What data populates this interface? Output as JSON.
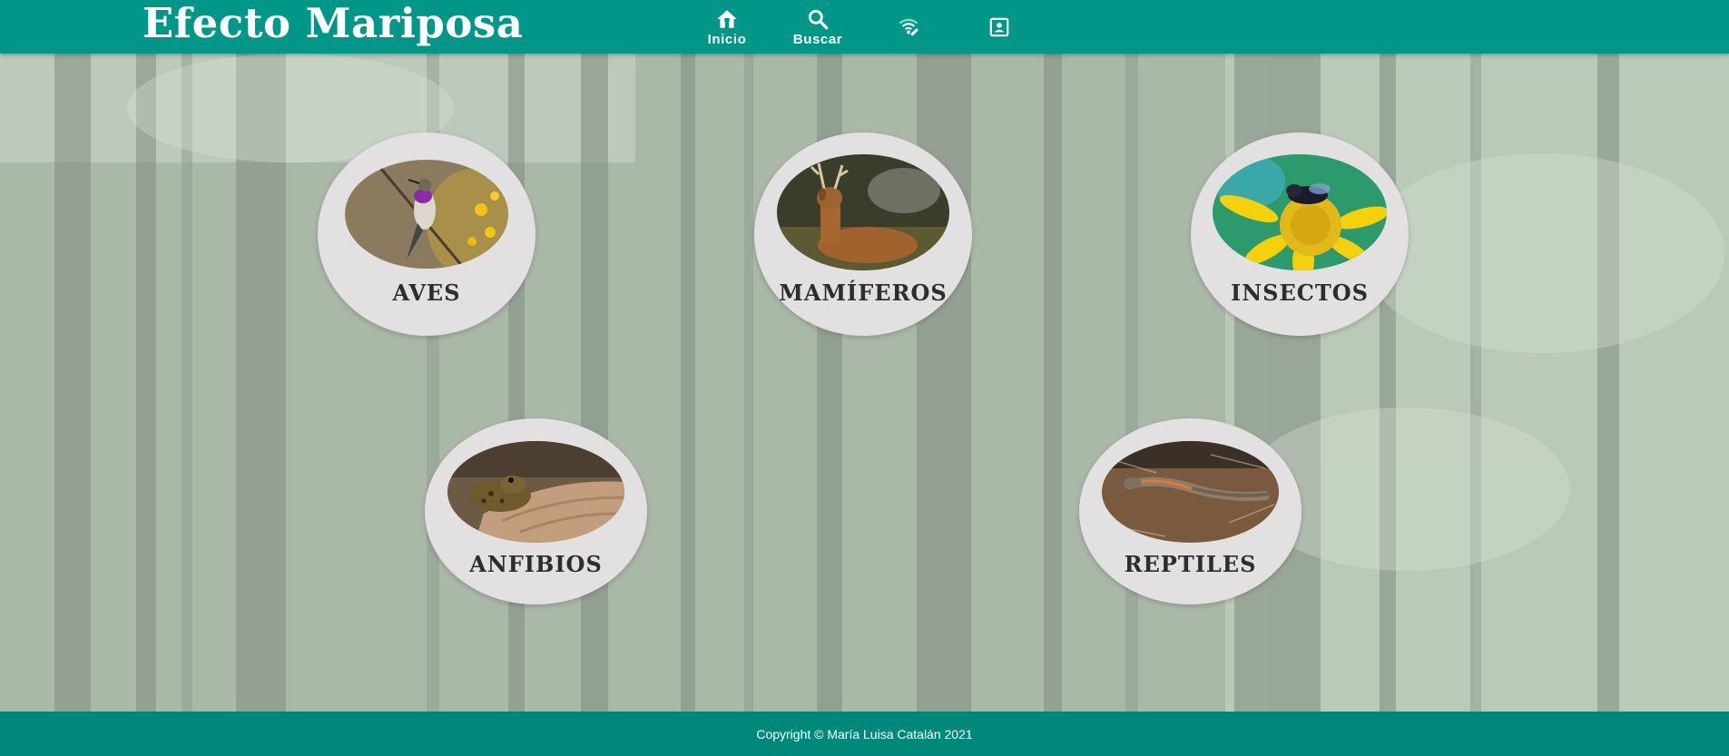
{
  "header": {
    "logo": "Efecto Mariposa",
    "nav": [
      {
        "label": "Inicio",
        "icon": "home-icon"
      },
      {
        "label": "Buscar",
        "icon": "search-icon"
      },
      {
        "label": "",
        "icon": "wifi-signal-icon"
      },
      {
        "label": "",
        "icon": "contact-card-icon"
      }
    ]
  },
  "categories": [
    {
      "label": "AVES",
      "image": "hummingbird"
    },
    {
      "label": "MAMÍFEROS",
      "image": "deer"
    },
    {
      "label": "INSECTOS",
      "image": "bee-on-flower"
    },
    {
      "label": "ANFIBIOS",
      "image": "toad"
    },
    {
      "label": "REPTILES",
      "image": "lizard"
    }
  ],
  "footer": {
    "copyright": "Copyright © María Luisa Catalán 2021"
  },
  "colors": {
    "header": "#009688",
    "footer": "#00897b",
    "card": "#e2e0e0"
  }
}
